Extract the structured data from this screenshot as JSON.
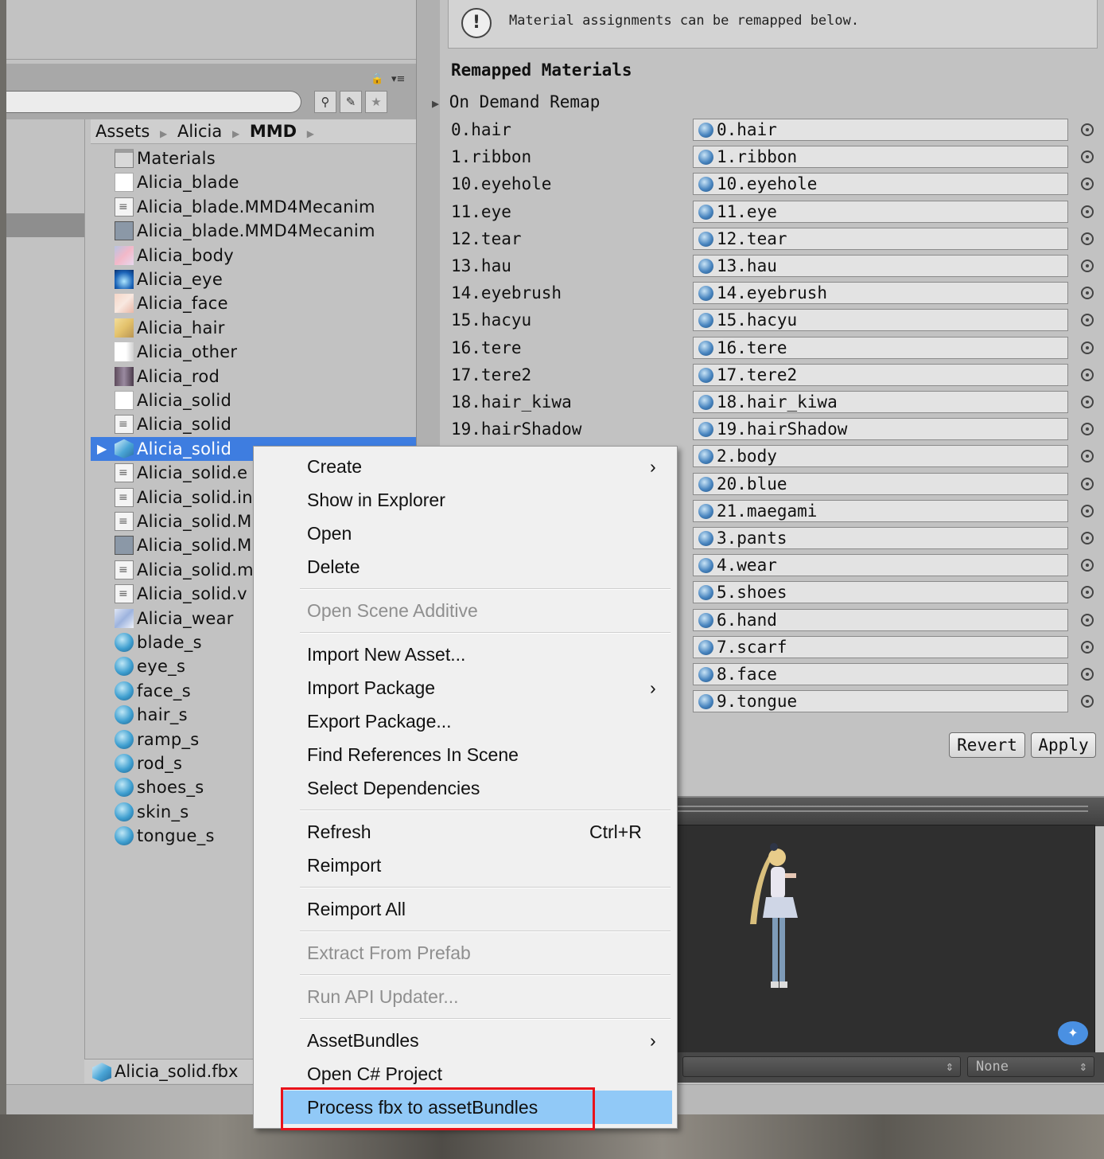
{
  "project_panel": {
    "breadcrumb": [
      "Assets",
      "Alicia",
      "MMD"
    ],
    "files": [
      {
        "name": "Materials",
        "icon": "folder-icon"
      },
      {
        "name": "Alicia_blade",
        "icon": "blank-file-icon"
      },
      {
        "name": "Alicia_blade.MMD4Mecanim",
        "icon": "text-file-icon"
      },
      {
        "name": "Alicia_blade.MMD4Mecanim",
        "icon": "animator-icon"
      },
      {
        "name": "Alicia_body",
        "icon": "texture-body-icon"
      },
      {
        "name": "Alicia_eye",
        "icon": "texture-eye-icon"
      },
      {
        "name": "Alicia_face",
        "icon": "texture-face-icon"
      },
      {
        "name": "Alicia_hair",
        "icon": "texture-hair-icon"
      },
      {
        "name": "Alicia_other",
        "icon": "texture-other-icon"
      },
      {
        "name": "Alicia_rod",
        "icon": "texture-rod-icon"
      },
      {
        "name": "Alicia_solid",
        "icon": "blank-file-icon"
      },
      {
        "name": "Alicia_solid",
        "icon": "text-file-icon"
      },
      {
        "name": "Alicia_solid",
        "icon": "model-icon",
        "selected": true
      },
      {
        "name": "Alicia_solid.e",
        "icon": "text-file-icon"
      },
      {
        "name": "Alicia_solid.in",
        "icon": "text-file-icon"
      },
      {
        "name": "Alicia_solid.M",
        "icon": "text-file-icon"
      },
      {
        "name": "Alicia_solid.M",
        "icon": "animator-icon"
      },
      {
        "name": "Alicia_solid.m",
        "icon": "text-file-icon"
      },
      {
        "name": "Alicia_solid.v",
        "icon": "text-file-icon"
      },
      {
        "name": "Alicia_wear",
        "icon": "texture-wear-icon"
      },
      {
        "name": "blade_s",
        "icon": "material-icon"
      },
      {
        "name": "eye_s",
        "icon": "material-icon"
      },
      {
        "name": "face_s",
        "icon": "material-icon"
      },
      {
        "name": "hair_s",
        "icon": "material-icon"
      },
      {
        "name": "ramp_s",
        "icon": "material-icon"
      },
      {
        "name": "rod_s",
        "icon": "material-icon"
      },
      {
        "name": "shoes_s",
        "icon": "material-icon"
      },
      {
        "name": "skin_s",
        "icon": "material-icon"
      },
      {
        "name": "tongue_s",
        "icon": "material-icon"
      }
    ],
    "footer_path": "Alicia_solid.fbx"
  },
  "inspector": {
    "info_text": "Material assignments can be remapped below.",
    "remap_title": "Remapped Materials",
    "foldout_label": "On Demand Remap",
    "materials": [
      {
        "label": "0.hair",
        "value": "0.hair"
      },
      {
        "label": "1.ribbon",
        "value": "1.ribbon"
      },
      {
        "label": "10.eyehole",
        "value": "10.eyehole"
      },
      {
        "label": "11.eye",
        "value": "11.eye"
      },
      {
        "label": "12.tear",
        "value": "12.tear"
      },
      {
        "label": "13.hau",
        "value": "13.hau"
      },
      {
        "label": "14.eyebrush",
        "value": "14.eyebrush"
      },
      {
        "label": "15.hacyu",
        "value": "15.hacyu"
      },
      {
        "label": "16.tere",
        "value": "16.tere"
      },
      {
        "label": "17.tere2",
        "value": "17.tere2"
      },
      {
        "label": "18.hair_kiwa",
        "value": "18.hair_kiwa"
      },
      {
        "label": "19.hairShadow",
        "value": "19.hairShadow"
      },
      {
        "label": "",
        "value": "2.body"
      },
      {
        "label": "",
        "value": "20.blue"
      },
      {
        "label": "",
        "value": "21.maegami"
      },
      {
        "label": "",
        "value": "3.pants"
      },
      {
        "label": "",
        "value": "4.wear"
      },
      {
        "label": "",
        "value": "5.shoes"
      },
      {
        "label": "",
        "value": "6.hand"
      },
      {
        "label": "",
        "value": "7.scarf"
      },
      {
        "label": "",
        "value": "8.face"
      },
      {
        "label": "",
        "value": "9.tongue"
      }
    ],
    "revert_label": "Revert",
    "apply_label": "Apply",
    "preview_dropdown_right": "None"
  },
  "context_menu": {
    "items": [
      {
        "label": "Create",
        "submenu": true,
        "disabled": false
      },
      {
        "label": "Show in Explorer",
        "disabled": false
      },
      {
        "label": "Open",
        "disabled": false
      },
      {
        "label": "Delete",
        "disabled": false
      },
      {
        "separator": true
      },
      {
        "label": "Open Scene Additive",
        "disabled": true
      },
      {
        "separator": true
      },
      {
        "label": "Import New Asset...",
        "disabled": false
      },
      {
        "label": "Import Package",
        "submenu": true,
        "disabled": false
      },
      {
        "label": "Export Package...",
        "disabled": false
      },
      {
        "label": "Find References In Scene",
        "disabled": false
      },
      {
        "label": "Select Dependencies",
        "disabled": false
      },
      {
        "separator": true
      },
      {
        "label": "Refresh",
        "shortcut": "Ctrl+R",
        "disabled": false
      },
      {
        "label": "Reimport",
        "disabled": false
      },
      {
        "separator": true
      },
      {
        "label": "Reimport All",
        "disabled": false
      },
      {
        "separator": true
      },
      {
        "label": "Extract From Prefab",
        "disabled": true
      },
      {
        "separator": true
      },
      {
        "label": "Run API Updater...",
        "disabled": true
      },
      {
        "separator": true
      },
      {
        "label": "AssetBundles",
        "submenu": true,
        "disabled": false
      },
      {
        "label": "Open C# Project",
        "disabled": false
      },
      {
        "label": "Process fbx to assetBundles",
        "disabled": false,
        "highlighted": true
      }
    ]
  },
  "colors": {
    "selection_blue": "#3e7de0",
    "menu_highlight": "#91c9f7",
    "annotation_red": "#e8121b"
  }
}
